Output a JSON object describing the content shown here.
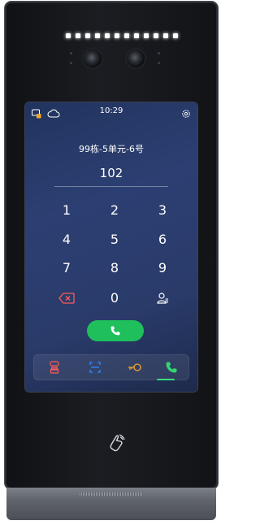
{
  "status_bar": {
    "time": "10:29",
    "left_icons": [
      "doorbell-monitor-icon",
      "cloud-icon"
    ],
    "right_icon": "settings-icon"
  },
  "address": {
    "label": "99栋-5单元-6号"
  },
  "input": {
    "value": "102"
  },
  "keypad": {
    "keys": [
      "1",
      "2",
      "3",
      "4",
      "5",
      "6",
      "7",
      "8",
      "9",
      "0"
    ],
    "delete_icon": "backspace-icon",
    "contacts_icon": "contacts-icon",
    "call_icon": "phone-call-icon"
  },
  "bottom_bar": {
    "items": [
      {
        "icon": "face-id-icon",
        "color": "#ff5a5a"
      },
      {
        "icon": "qr-scan-icon",
        "color": "#2f8cff"
      },
      {
        "icon": "key-icon",
        "color": "#f2a72b"
      },
      {
        "icon": "phone-icon",
        "color": "#30d86f"
      }
    ]
  },
  "colors": {
    "screen_bg": "#26386a",
    "call_green": "#1fbf5b",
    "delete_red": "#ff5a5a"
  }
}
